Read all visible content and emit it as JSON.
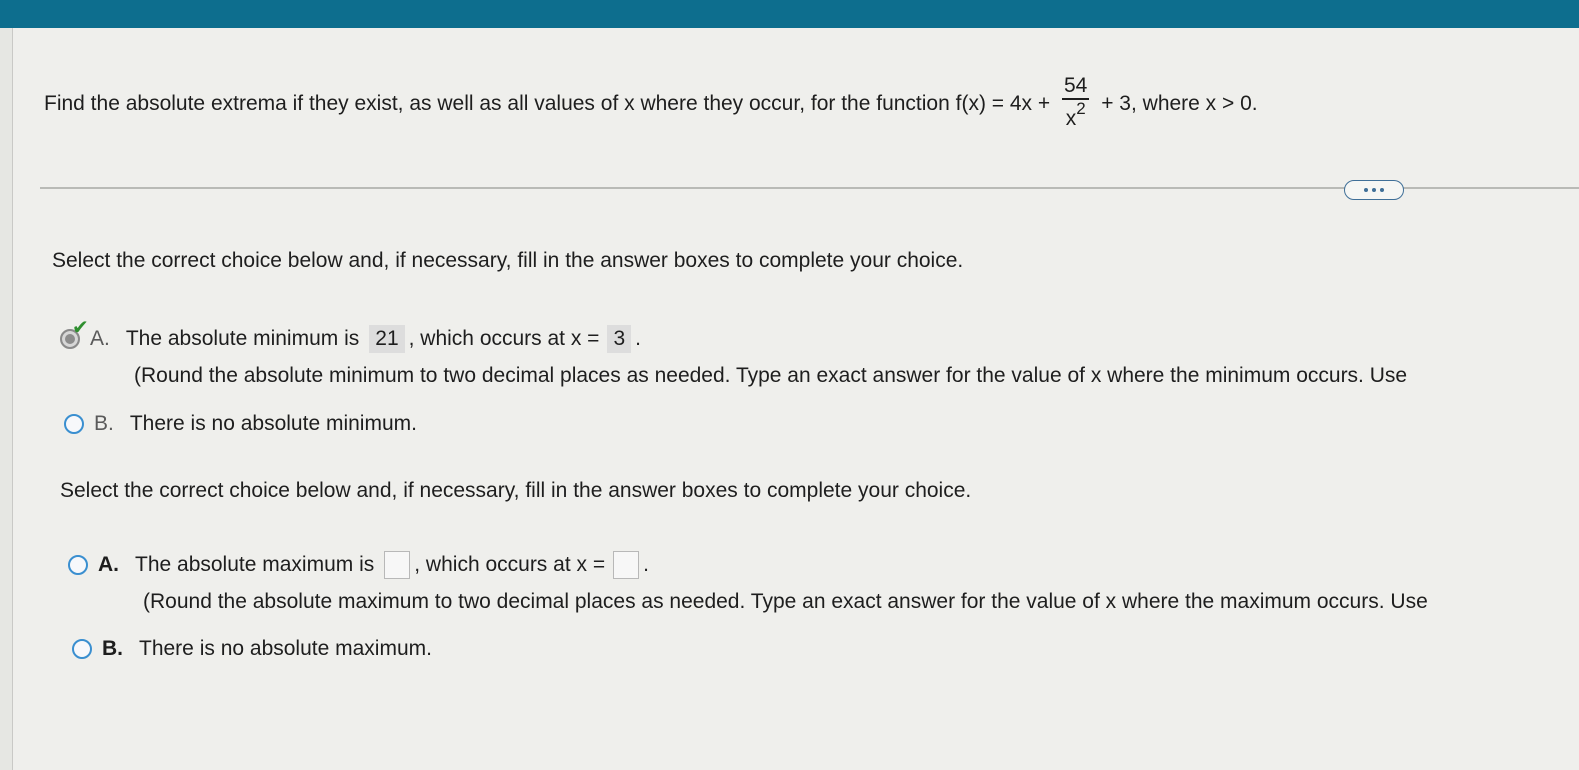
{
  "question": {
    "prefix": "Find the absolute extrema if they exist, as well as all values of x where they occur, for the function f(x) = 4x +",
    "frac_num": "54",
    "frac_den": "x",
    "frac_exp": "2",
    "suffix": "+ 3, where x > 0."
  },
  "more_button": {
    "icon": "ellipsis-icon"
  },
  "part1": {
    "instruction": "Select the correct choice below and, if necessary, fill in the answer boxes to complete your choice.",
    "choice_a": {
      "letter": "A.",
      "text1": "The absolute minimum is",
      "answer1": "21",
      "text2": ", which occurs at x =",
      "answer2": "3",
      "text3": ".",
      "note": "(Round the absolute minimum to two decimal places as needed. Type an exact answer for the value of x where the minimum occurs. Use"
    },
    "choice_b": {
      "letter": "B.",
      "text": "There is no absolute minimum."
    }
  },
  "part2": {
    "instruction": "Select the correct choice below and, if necessary, fill in the answer boxes to complete your choice.",
    "choice_a": {
      "letter": "A.",
      "text1": "The absolute maximum is",
      "text2": ", which occurs at x =",
      "text3": ".",
      "note": "(Round the absolute maximum to two decimal places as needed. Type an exact answer for the value of x where the maximum occurs. Use"
    },
    "choice_b": {
      "letter": "B.",
      "text": "There is no absolute maximum."
    }
  },
  "colors": {
    "topbar": "#0d6e8e",
    "radio_border": "#3a8fd0",
    "check": "#2f8f2f"
  }
}
